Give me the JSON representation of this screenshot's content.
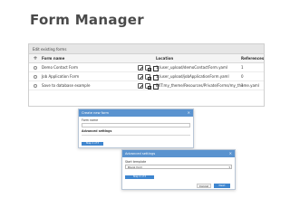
{
  "page": {
    "title": "Form Manager"
  },
  "panel": {
    "header": "Edit existing forms",
    "columns": {
      "name": "Form name",
      "location": "Location",
      "references": "References"
    },
    "rows": [
      {
        "name": "Demo Contact Form",
        "location": "1:/user_upload/demoContactForm.yaml",
        "references": "1"
      },
      {
        "name": "Job Application Form",
        "location": "1:/user_upload/jobApplicationForm.yaml",
        "references": "0"
      },
      {
        "name": "Save to database example",
        "location": "EXT:my_theme/Resources/Private/Forms/my_theme.yaml",
        "references": "1"
      }
    ]
  },
  "dialog_create": {
    "title": "Create new form",
    "name_label": "Form name",
    "advanced_label": "Advanced settings",
    "button": "Step 1 of 3"
  },
  "dialog_advanced": {
    "title": "Advanced settings",
    "template_label": "Start template",
    "template_value": "Blank form",
    "progress": "Step 2 of 3",
    "cancel": "Cancel",
    "next": "Next"
  }
}
